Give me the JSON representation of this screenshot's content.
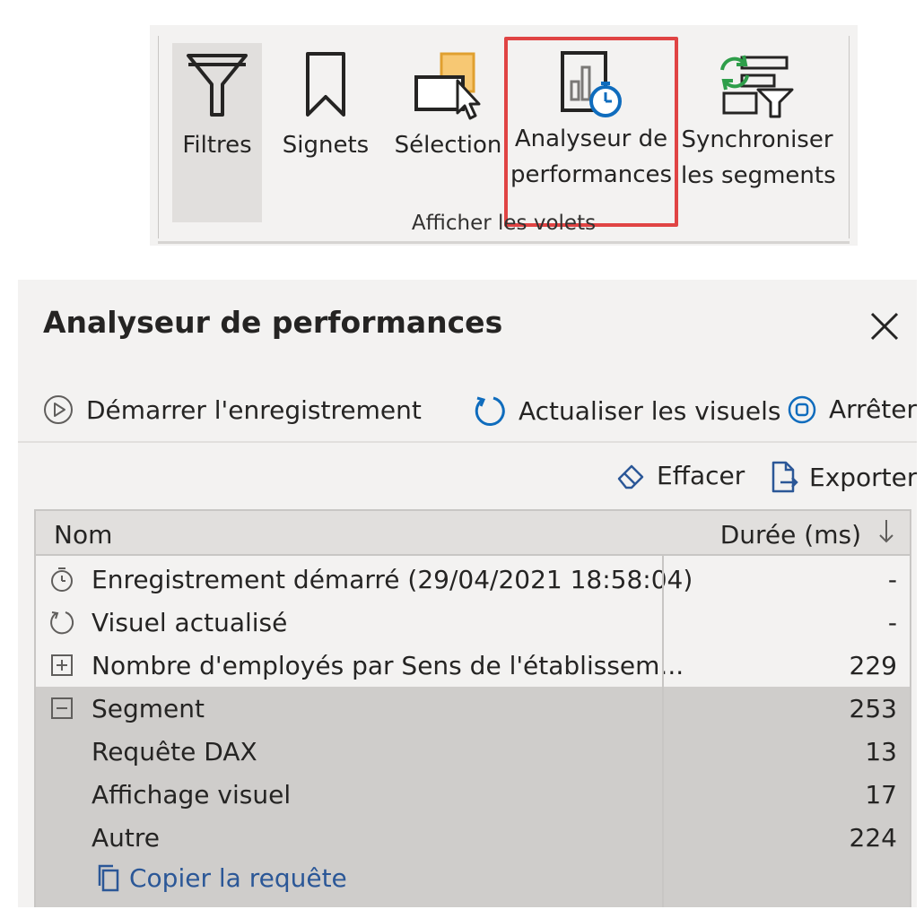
{
  "ribbon": {
    "buttons": [
      {
        "label": "Filtres",
        "icon": "filter-icon"
      },
      {
        "label": "Signets",
        "icon": "bookmark-icon"
      },
      {
        "label": "Sélection",
        "icon": "selection-icon"
      },
      {
        "label_line1": "Analyseur de",
        "label_line2": "performances",
        "icon": "performance-analyzer-icon"
      },
      {
        "label_line1": "Synchroniser",
        "label_line2": "les segments",
        "icon": "sync-slicers-icon"
      }
    ],
    "group_label": "Afficher les volets"
  },
  "pane": {
    "title": "Analyseur de performances",
    "toolbar": {
      "start": "Démarrer l'enregistrement",
      "refresh": "Actualiser les visuels",
      "stop": "Arrêter",
      "clear": "Effacer",
      "export": "Exporter"
    },
    "table": {
      "col_name": "Nom",
      "col_duration": "Durée (ms)",
      "rows": [
        {
          "name": "Enregistrement démarré (29/04/2021 18:58:04)",
          "duration": "-",
          "icon": "timer-icon"
        },
        {
          "name": "Visuel actualisé",
          "duration": "-",
          "icon": "refresh-icon"
        },
        {
          "name": "Nombre d'employés par Sens de l'établissem...",
          "duration": "229",
          "icon": "expand-icon"
        },
        {
          "name": "Segment",
          "duration": "253",
          "icon": "collapse-icon"
        },
        {
          "name": "Requête DAX",
          "duration": "13"
        },
        {
          "name": "Affichage visuel",
          "duration": "17"
        },
        {
          "name": "Autre",
          "duration": "224"
        }
      ],
      "copy_query": "Copier la requête"
    }
  },
  "colors": {
    "highlight_border": "#e04444",
    "link": "#2b5797",
    "selected_row": "#cfcdcb",
    "accent_blue": "#0f6cbd",
    "accent_green": "#2e9e4a",
    "accent_orange": "#f2b24a"
  }
}
